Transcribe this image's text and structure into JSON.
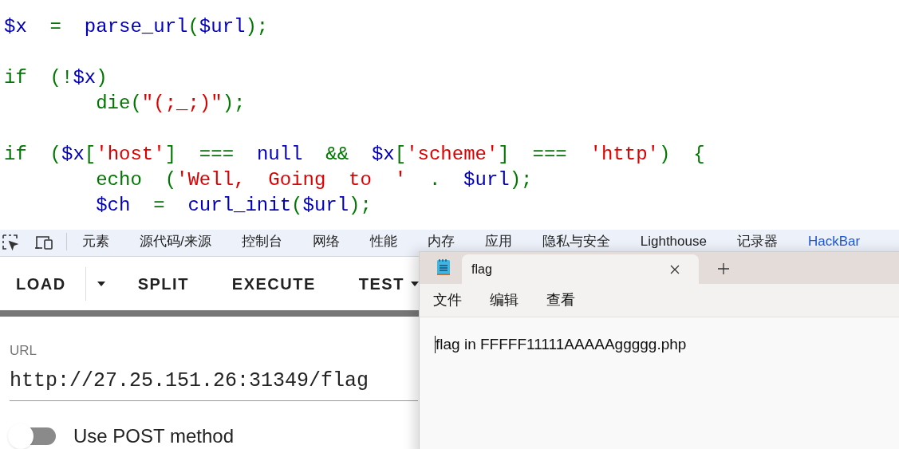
{
  "code": {
    "lines": [
      {
        "kind": "code",
        "segments": [
          {
            "kind": "default",
            "text": "$x"
          },
          {
            "kind": "keyword",
            "text": "  =  "
          },
          {
            "kind": "default",
            "text": "parse_url"
          },
          {
            "kind": "keyword",
            "text": "("
          },
          {
            "kind": "default",
            "text": "$url"
          },
          {
            "kind": "keyword",
            "text": ");"
          }
        ]
      },
      {
        "kind": "blank"
      },
      {
        "kind": "code",
        "segments": [
          {
            "kind": "keyword",
            "text": "if  (!"
          },
          {
            "kind": "default",
            "text": "$x"
          },
          {
            "kind": "keyword",
            "text": ")"
          }
        ]
      },
      {
        "kind": "code",
        "segments": [
          {
            "kind": "keyword",
            "text": "        die("
          },
          {
            "kind": "string",
            "text": "\"(;_;)\""
          },
          {
            "kind": "keyword",
            "text": ");"
          }
        ]
      },
      {
        "kind": "blank"
      },
      {
        "kind": "code",
        "segments": [
          {
            "kind": "keyword",
            "text": "if  ("
          },
          {
            "kind": "default",
            "text": "$x"
          },
          {
            "kind": "keyword",
            "text": "["
          },
          {
            "kind": "string",
            "text": "'host'"
          },
          {
            "kind": "keyword",
            "text": "]  ===  "
          },
          {
            "kind": "default",
            "text": "null"
          },
          {
            "kind": "keyword",
            "text": "  &&  "
          },
          {
            "kind": "default",
            "text": "$x"
          },
          {
            "kind": "keyword",
            "text": "["
          },
          {
            "kind": "string",
            "text": "'scheme'"
          },
          {
            "kind": "keyword",
            "text": "]  ===  "
          },
          {
            "kind": "string",
            "text": "'http'"
          },
          {
            "kind": "keyword",
            "text": ")  {"
          }
        ]
      },
      {
        "kind": "code",
        "segments": [
          {
            "kind": "keyword",
            "text": "        echo  ("
          },
          {
            "kind": "string",
            "text": "'Well,  Going  to  '"
          },
          {
            "kind": "keyword",
            "text": "  .  "
          },
          {
            "kind": "default",
            "text": "$url"
          },
          {
            "kind": "keyword",
            "text": ");"
          }
        ]
      },
      {
        "kind": "code",
        "segments": [
          {
            "kind": "default",
            "text": "        $ch"
          },
          {
            "kind": "keyword",
            "text": "  =  "
          },
          {
            "kind": "default",
            "text": "curl_init"
          },
          {
            "kind": "keyword",
            "text": "("
          },
          {
            "kind": "default",
            "text": "$url"
          },
          {
            "kind": "keyword",
            "text": ");"
          }
        ]
      }
    ]
  },
  "devtools": {
    "tabs": [
      {
        "label": "元素",
        "selected": false
      },
      {
        "label": "源代码/来源",
        "selected": false
      },
      {
        "label": "控制台",
        "selected": false
      },
      {
        "label": "网络",
        "selected": false
      },
      {
        "label": "性能",
        "selected": false
      },
      {
        "label": "内存",
        "selected": false
      },
      {
        "label": "应用",
        "selected": false
      },
      {
        "label": "隐私与安全",
        "selected": false
      },
      {
        "label": "Lighthouse",
        "selected": false
      },
      {
        "label": "记录器",
        "selected": false
      },
      {
        "label": "HackBar",
        "selected": true
      }
    ]
  },
  "hackbar": {
    "buttons": [
      {
        "label": "LOAD",
        "kind": "split_menu"
      },
      {
        "label": "SPLIT",
        "kind": "plain"
      },
      {
        "label": "EXECUTE",
        "kind": "plain"
      },
      {
        "label": "TEST",
        "kind": "menu"
      }
    ],
    "url_field": {
      "label": "URL",
      "value": "http://27.25.151.26:31349/flag"
    },
    "post_toggle": {
      "label": "Use POST method",
      "on": false
    }
  },
  "notepad": {
    "tab_title": "flag",
    "menu": [
      "文件",
      "编辑",
      "查看"
    ],
    "content": "flag in FFFFF11111AAAAAggggg.php"
  }
}
